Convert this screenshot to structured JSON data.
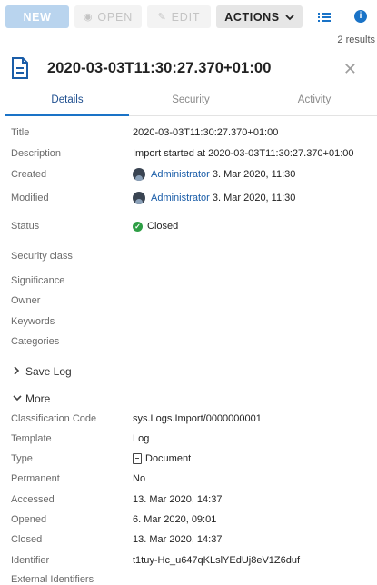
{
  "toolbar": {
    "new_label": "NEW",
    "open_label": "OPEN",
    "edit_label": "EDIT",
    "actions_label": "ACTIONS",
    "results_text": "2 results",
    "accent_color": "#1a73c7"
  },
  "header": {
    "title": "2020-03-03T11:30:27.370+01:00",
    "icon": "document-icon"
  },
  "tabs": [
    {
      "label": "Details",
      "active": true
    },
    {
      "label": "Security",
      "active": false
    },
    {
      "label": "Activity",
      "active": false
    }
  ],
  "details": {
    "title_label": "Title",
    "title_value": "2020-03-03T11:30:27.370+01:00",
    "description_label": "Description",
    "description_value": "Import started at 2020-03-03T11:30:27.370+01:00",
    "created_label": "Created",
    "created_user": "Administrator",
    "created_date": "3. Mar 2020, 11:30",
    "modified_label": "Modified",
    "modified_user": "Administrator",
    "modified_date": "3. Mar 2020, 11:30",
    "status_label": "Status",
    "status_value": "Closed",
    "status_color": "#2e9e45",
    "security_class_label": "Security class",
    "significance_label": "Significance",
    "owner_label": "Owner",
    "keywords_label": "Keywords",
    "categories_label": "Categories"
  },
  "sections": {
    "save_log": "Save Log",
    "more": "More"
  },
  "more": {
    "classification_code_label": "Classification Code",
    "classification_code_value": "sys.Logs.Import/0000000001",
    "template_label": "Template",
    "template_value": "Log",
    "type_label": "Type",
    "type_value": "Document",
    "permanent_label": "Permanent",
    "permanent_value": "No",
    "accessed_label": "Accessed",
    "accessed_value": "13. Mar 2020, 14:37",
    "opened_label": "Opened",
    "opened_value": "6. Mar 2020, 09:01",
    "closed_label": "Closed",
    "closed_value": "13. Mar 2020, 14:37",
    "identifier_label": "Identifier",
    "identifier_value": "t1tuy-Hc_u647qKLslYEdUj8eV1Z6duf",
    "external_identifiers_label": "External Identifiers"
  }
}
